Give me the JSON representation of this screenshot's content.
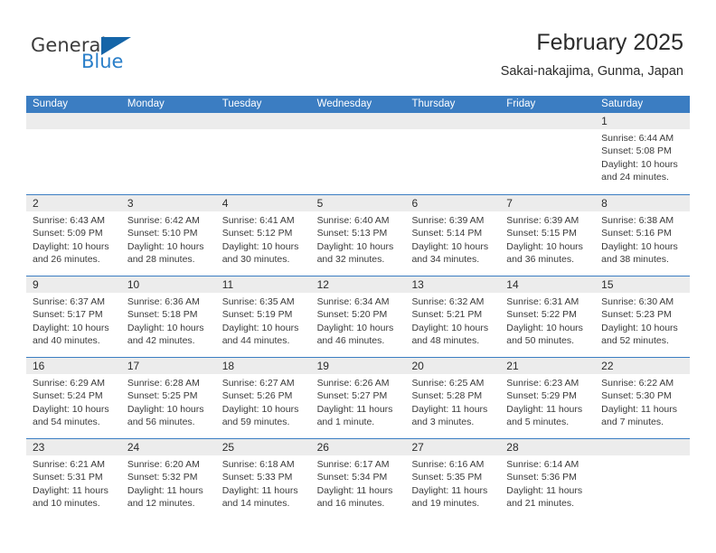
{
  "brand": {
    "word1": "General",
    "word2": "Blue",
    "triangle_color": "#1565a8",
    "blue_color": "#2a7fc9"
  },
  "header": {
    "title": "February 2025",
    "subtitle": "Sakai-nakajima, Gunma, Japan"
  },
  "theme": {
    "header_blue": "#3b7dc2",
    "daynum_band": "#ececec",
    "text": "#2b2b2b"
  },
  "weekdays": [
    "Sunday",
    "Monday",
    "Tuesday",
    "Wednesday",
    "Thursday",
    "Friday",
    "Saturday"
  ],
  "weeks": [
    [
      {
        "day": "",
        "sunrise": "",
        "sunset": "",
        "daylight_line1": "",
        "daylight_line2": ""
      },
      {
        "day": "",
        "sunrise": "",
        "sunset": "",
        "daylight_line1": "",
        "daylight_line2": ""
      },
      {
        "day": "",
        "sunrise": "",
        "sunset": "",
        "daylight_line1": "",
        "daylight_line2": ""
      },
      {
        "day": "",
        "sunrise": "",
        "sunset": "",
        "daylight_line1": "",
        "daylight_line2": ""
      },
      {
        "day": "",
        "sunrise": "",
        "sunset": "",
        "daylight_line1": "",
        "daylight_line2": ""
      },
      {
        "day": "",
        "sunrise": "",
        "sunset": "",
        "daylight_line1": "",
        "daylight_line2": ""
      },
      {
        "day": "1",
        "sunrise": "Sunrise: 6:44 AM",
        "sunset": "Sunset: 5:08 PM",
        "daylight_line1": "Daylight: 10 hours",
        "daylight_line2": "and 24 minutes."
      }
    ],
    [
      {
        "day": "2",
        "sunrise": "Sunrise: 6:43 AM",
        "sunset": "Sunset: 5:09 PM",
        "daylight_line1": "Daylight: 10 hours",
        "daylight_line2": "and 26 minutes."
      },
      {
        "day": "3",
        "sunrise": "Sunrise: 6:42 AM",
        "sunset": "Sunset: 5:10 PM",
        "daylight_line1": "Daylight: 10 hours",
        "daylight_line2": "and 28 minutes."
      },
      {
        "day": "4",
        "sunrise": "Sunrise: 6:41 AM",
        "sunset": "Sunset: 5:12 PM",
        "daylight_line1": "Daylight: 10 hours",
        "daylight_line2": "and 30 minutes."
      },
      {
        "day": "5",
        "sunrise": "Sunrise: 6:40 AM",
        "sunset": "Sunset: 5:13 PM",
        "daylight_line1": "Daylight: 10 hours",
        "daylight_line2": "and 32 minutes."
      },
      {
        "day": "6",
        "sunrise": "Sunrise: 6:39 AM",
        "sunset": "Sunset: 5:14 PM",
        "daylight_line1": "Daylight: 10 hours",
        "daylight_line2": "and 34 minutes."
      },
      {
        "day": "7",
        "sunrise": "Sunrise: 6:39 AM",
        "sunset": "Sunset: 5:15 PM",
        "daylight_line1": "Daylight: 10 hours",
        "daylight_line2": "and 36 minutes."
      },
      {
        "day": "8",
        "sunrise": "Sunrise: 6:38 AM",
        "sunset": "Sunset: 5:16 PM",
        "daylight_line1": "Daylight: 10 hours",
        "daylight_line2": "and 38 minutes."
      }
    ],
    [
      {
        "day": "9",
        "sunrise": "Sunrise: 6:37 AM",
        "sunset": "Sunset: 5:17 PM",
        "daylight_line1": "Daylight: 10 hours",
        "daylight_line2": "and 40 minutes."
      },
      {
        "day": "10",
        "sunrise": "Sunrise: 6:36 AM",
        "sunset": "Sunset: 5:18 PM",
        "daylight_line1": "Daylight: 10 hours",
        "daylight_line2": "and 42 minutes."
      },
      {
        "day": "11",
        "sunrise": "Sunrise: 6:35 AM",
        "sunset": "Sunset: 5:19 PM",
        "daylight_line1": "Daylight: 10 hours",
        "daylight_line2": "and 44 minutes."
      },
      {
        "day": "12",
        "sunrise": "Sunrise: 6:34 AM",
        "sunset": "Sunset: 5:20 PM",
        "daylight_line1": "Daylight: 10 hours",
        "daylight_line2": "and 46 minutes."
      },
      {
        "day": "13",
        "sunrise": "Sunrise: 6:32 AM",
        "sunset": "Sunset: 5:21 PM",
        "daylight_line1": "Daylight: 10 hours",
        "daylight_line2": "and 48 minutes."
      },
      {
        "day": "14",
        "sunrise": "Sunrise: 6:31 AM",
        "sunset": "Sunset: 5:22 PM",
        "daylight_line1": "Daylight: 10 hours",
        "daylight_line2": "and 50 minutes."
      },
      {
        "day": "15",
        "sunrise": "Sunrise: 6:30 AM",
        "sunset": "Sunset: 5:23 PM",
        "daylight_line1": "Daylight: 10 hours",
        "daylight_line2": "and 52 minutes."
      }
    ],
    [
      {
        "day": "16",
        "sunrise": "Sunrise: 6:29 AM",
        "sunset": "Sunset: 5:24 PM",
        "daylight_line1": "Daylight: 10 hours",
        "daylight_line2": "and 54 minutes."
      },
      {
        "day": "17",
        "sunrise": "Sunrise: 6:28 AM",
        "sunset": "Sunset: 5:25 PM",
        "daylight_line1": "Daylight: 10 hours",
        "daylight_line2": "and 56 minutes."
      },
      {
        "day": "18",
        "sunrise": "Sunrise: 6:27 AM",
        "sunset": "Sunset: 5:26 PM",
        "daylight_line1": "Daylight: 10 hours",
        "daylight_line2": "and 59 minutes."
      },
      {
        "day": "19",
        "sunrise": "Sunrise: 6:26 AM",
        "sunset": "Sunset: 5:27 PM",
        "daylight_line1": "Daylight: 11 hours",
        "daylight_line2": "and 1 minute."
      },
      {
        "day": "20",
        "sunrise": "Sunrise: 6:25 AM",
        "sunset": "Sunset: 5:28 PM",
        "daylight_line1": "Daylight: 11 hours",
        "daylight_line2": "and 3 minutes."
      },
      {
        "day": "21",
        "sunrise": "Sunrise: 6:23 AM",
        "sunset": "Sunset: 5:29 PM",
        "daylight_line1": "Daylight: 11 hours",
        "daylight_line2": "and 5 minutes."
      },
      {
        "day": "22",
        "sunrise": "Sunrise: 6:22 AM",
        "sunset": "Sunset: 5:30 PM",
        "daylight_line1": "Daylight: 11 hours",
        "daylight_line2": "and 7 minutes."
      }
    ],
    [
      {
        "day": "23",
        "sunrise": "Sunrise: 6:21 AM",
        "sunset": "Sunset: 5:31 PM",
        "daylight_line1": "Daylight: 11 hours",
        "daylight_line2": "and 10 minutes."
      },
      {
        "day": "24",
        "sunrise": "Sunrise: 6:20 AM",
        "sunset": "Sunset: 5:32 PM",
        "daylight_line1": "Daylight: 11 hours",
        "daylight_line2": "and 12 minutes."
      },
      {
        "day": "25",
        "sunrise": "Sunrise: 6:18 AM",
        "sunset": "Sunset: 5:33 PM",
        "daylight_line1": "Daylight: 11 hours",
        "daylight_line2": "and 14 minutes."
      },
      {
        "day": "26",
        "sunrise": "Sunrise: 6:17 AM",
        "sunset": "Sunset: 5:34 PM",
        "daylight_line1": "Daylight: 11 hours",
        "daylight_line2": "and 16 minutes."
      },
      {
        "day": "27",
        "sunrise": "Sunrise: 6:16 AM",
        "sunset": "Sunset: 5:35 PM",
        "daylight_line1": "Daylight: 11 hours",
        "daylight_line2": "and 19 minutes."
      },
      {
        "day": "28",
        "sunrise": "Sunrise: 6:14 AM",
        "sunset": "Sunset: 5:36 PM",
        "daylight_line1": "Daylight: 11 hours",
        "daylight_line2": "and 21 minutes."
      },
      {
        "day": "",
        "sunrise": "",
        "sunset": "",
        "daylight_line1": "",
        "daylight_line2": ""
      }
    ]
  ]
}
